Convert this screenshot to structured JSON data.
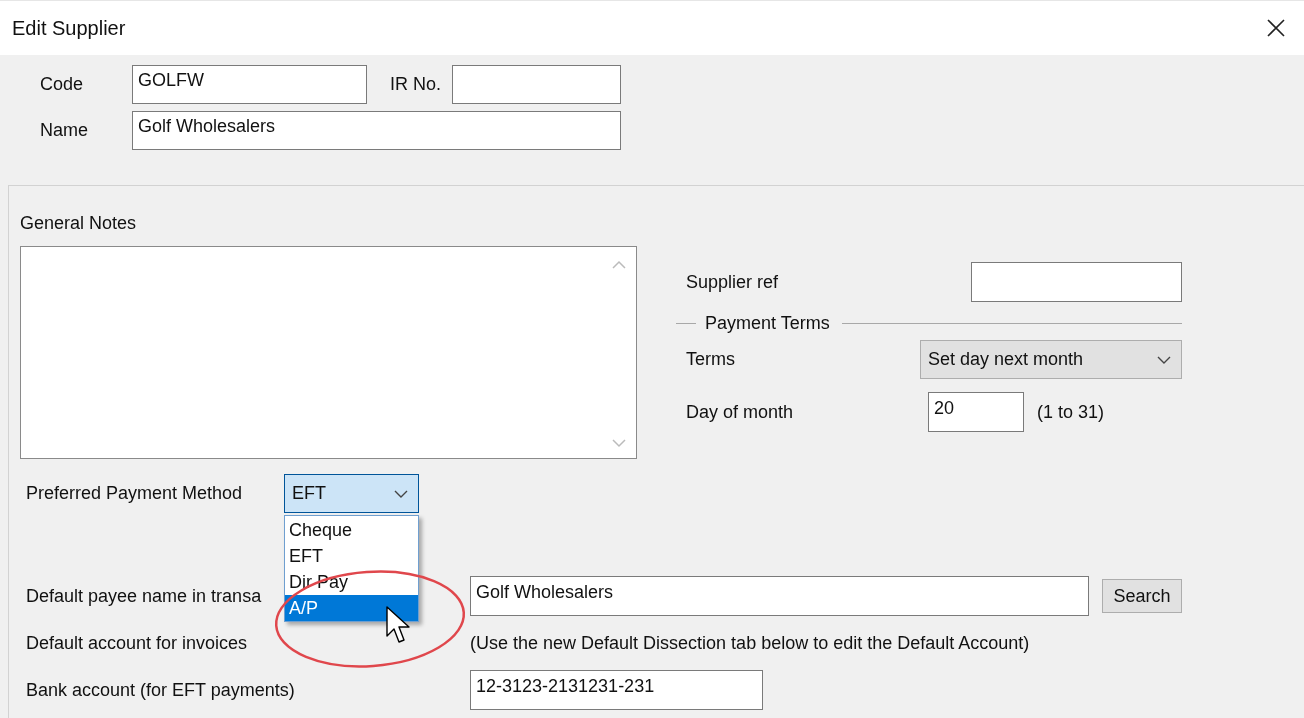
{
  "window": {
    "title": "Edit Supplier"
  },
  "header": {
    "code": {
      "label": "Code",
      "value": "GOLFW"
    },
    "ir_no": {
      "label": "IR No."
    },
    "name": {
      "label": "Name",
      "value": "Golf Wholesalers"
    }
  },
  "general_notes": {
    "label": "General Notes"
  },
  "supplier_ref": {
    "label": "Supplier ref"
  },
  "payment_terms": {
    "title": "Payment Terms",
    "terms": {
      "label": "Terms",
      "value": "Set day next month"
    },
    "day_of_month": {
      "label": "Day of month",
      "value": "20",
      "hint": "(1 to 31)"
    }
  },
  "payment_method": {
    "label": "Preferred Payment Method",
    "value": "EFT",
    "expanded": true,
    "options": [
      {
        "label": "Cheque",
        "highlighted": false
      },
      {
        "label": "EFT",
        "highlighted": false
      },
      {
        "label": "Dir Pay",
        "highlighted": false
      },
      {
        "label": "A/P",
        "highlighted": true
      }
    ]
  },
  "payee": {
    "label": "Default payee name in transa",
    "value": "Golf Wholesalers",
    "button": "Search"
  },
  "default_account": {
    "label": "Default account for invoices",
    "note": "(Use the new Default Dissection tab below to edit the Default Account)"
  },
  "bank_account": {
    "label": "Bank account (for EFT payments)",
    "value": "12-3123-2131231-231"
  }
}
